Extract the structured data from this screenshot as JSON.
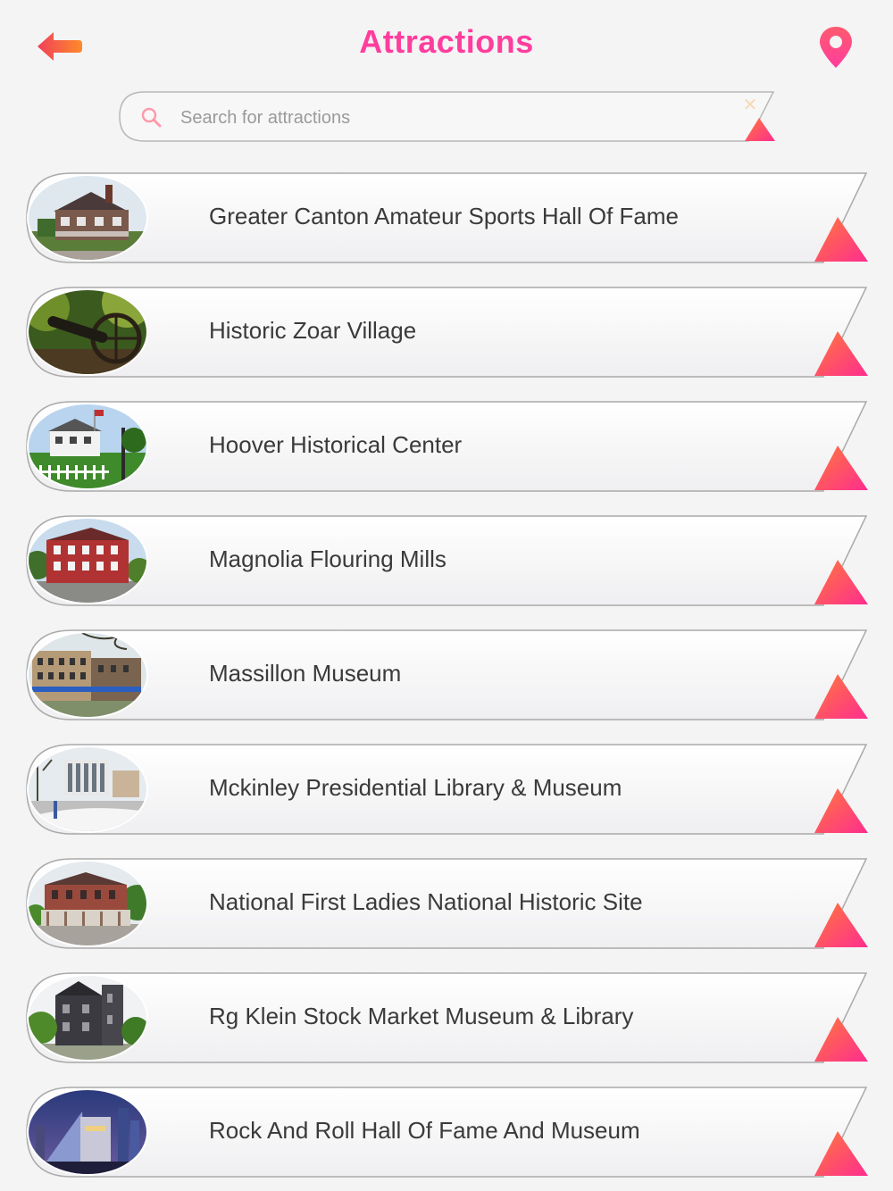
{
  "header": {
    "title": "Attractions",
    "back_icon": "arrow-left-icon",
    "map_icon": "map-pin-icon"
  },
  "search": {
    "placeholder": "Search for attractions",
    "value": "",
    "search_icon": "search-icon",
    "clear_icon": "clear-icon"
  },
  "colors": {
    "accent": "#ff3d9d",
    "accent_orange": "#ff6a3d",
    "back_arrow_red": "#f0405a",
    "back_arrow_orange": "#ff8a2a"
  },
  "attractions": [
    {
      "name": "Greater Canton Amateur Sports Hall Of Fame",
      "thumb": "victorian-house"
    },
    {
      "name": "Historic Zoar Village",
      "thumb": "cannon-in-forest"
    },
    {
      "name": "Hoover Historical Center",
      "thumb": "white-farmhouse"
    },
    {
      "name": "Magnolia Flouring Mills",
      "thumb": "red-mill"
    },
    {
      "name": "Massillon Museum",
      "thumb": "downtown-building"
    },
    {
      "name": "Mckinley Presidential Library & Museum",
      "thumb": "memorial-building"
    },
    {
      "name": "National First Ladies National Historic Site",
      "thumb": "brick-mansion"
    },
    {
      "name": "Rg Klein Stock Market Museum & Library",
      "thumb": "dark-stone-house"
    },
    {
      "name": "Rock And Roll Hall Of Fame And Museum",
      "thumb": "glass-pyramid-night"
    }
  ]
}
